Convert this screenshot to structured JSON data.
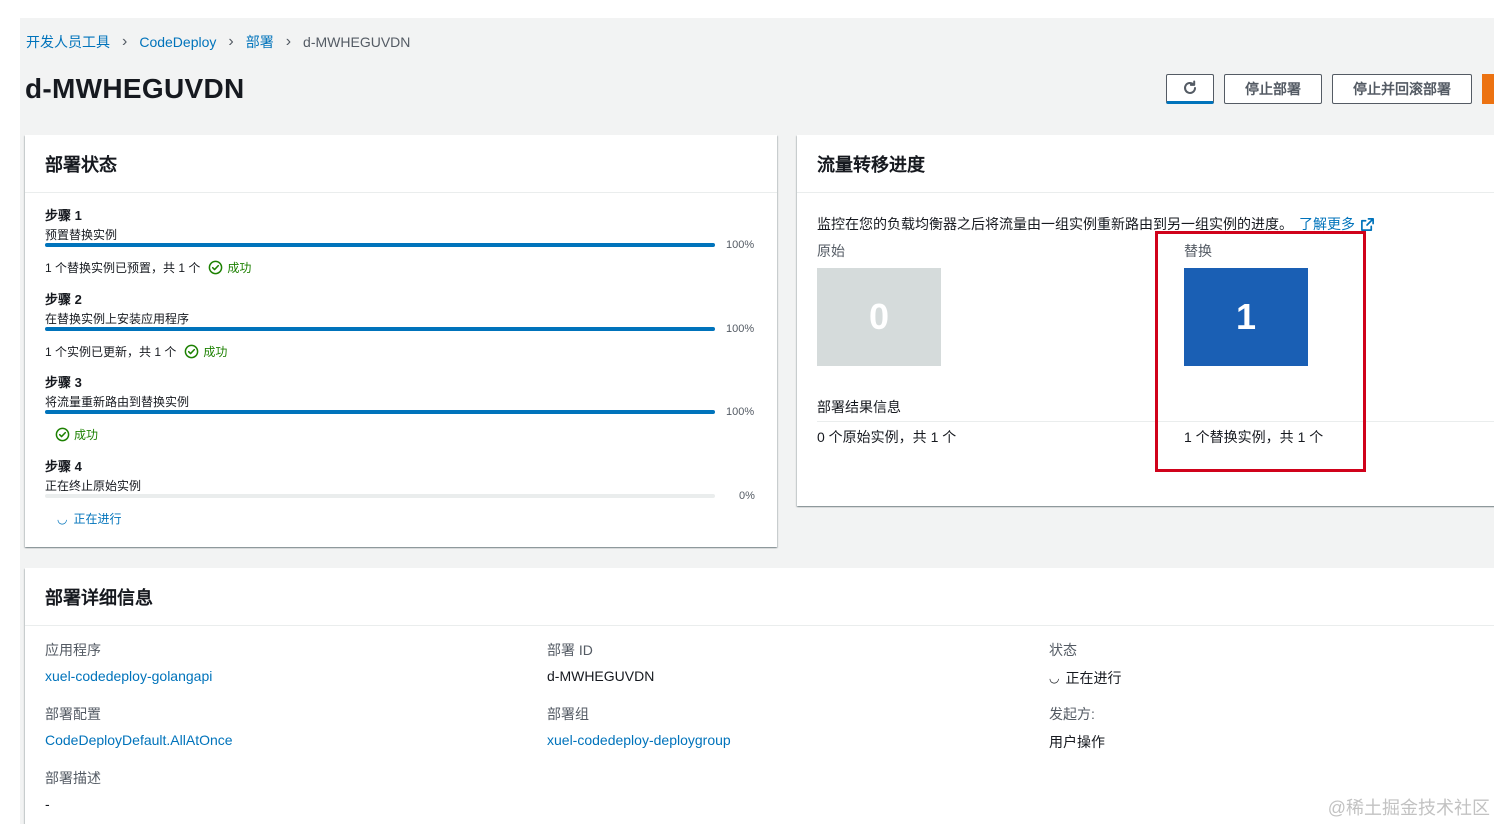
{
  "breadcrumb": {
    "items": [
      "开发人员工具",
      "CodeDeploy",
      "部署"
    ],
    "current": "d-MWHEGUVDN"
  },
  "page": {
    "title": "d-MWHEGUVDN"
  },
  "actions": {
    "refresh_icon": "refresh-icon",
    "stop_label": "停止部署",
    "stop_rollback_label": "停止并回滚部署"
  },
  "status_panel": {
    "title": "部署状态",
    "steps": [
      {
        "title": "步骤 1",
        "desc": "预置替换实例",
        "progress": 100,
        "pct": "100%",
        "note": "1 个替换实例已预置，共 1 个",
        "status": "成功"
      },
      {
        "title": "步骤 2",
        "desc": "在替换实例上安装应用程序",
        "progress": 100,
        "pct": "100%",
        "note": "1 个实例已更新，共 1 个",
        "status": "成功"
      },
      {
        "title": "步骤 3",
        "desc": "将流量重新路由到替换实例",
        "progress": 100,
        "pct": "100%",
        "note": "",
        "status": "成功"
      },
      {
        "title": "步骤 4",
        "desc": "正在终止原始实例",
        "progress": 0,
        "pct": "0%",
        "note": "",
        "status": "正在进行"
      }
    ]
  },
  "traffic_panel": {
    "title": "流量转移进度",
    "description": "监控在您的负载均衡器之后将流量由一组实例重新路由到另一组实例的进度。",
    "learn_more": "了解更多",
    "original_label": "原始",
    "original_count": "0",
    "replacement_label": "替换",
    "replacement_count": "1",
    "result_title": "部署结果信息",
    "original_result": "0 个原始实例，共 1 个",
    "replacement_result": "1 个替换实例，共 1 个"
  },
  "details_panel": {
    "title": "部署详细信息",
    "application_label": "应用程序",
    "application_value": "xuel-codedeploy-golangapi",
    "deployment_id_label": "部署 ID",
    "deployment_id_value": "d-MWHEGUVDN",
    "status_label": "状态",
    "status_value": "正在进行",
    "config_label": "部署配置",
    "config_value": "CodeDeployDefault.AllAtOnce",
    "group_label": "部署组",
    "group_value": "xuel-codedeploy-deploygroup",
    "initiator_label": "发起方:",
    "initiator_value": "用户操作",
    "description_label": "部署描述",
    "description_value": "-"
  },
  "watermark": "@稀土掘金技术社区",
  "colors": {
    "link": "#0073bb",
    "success": "#1d8102",
    "replacement_tile": "#1a5fb4",
    "original_tile": "#d5dbdb",
    "highlight": "#d0021b",
    "accent": "#ec7211"
  }
}
